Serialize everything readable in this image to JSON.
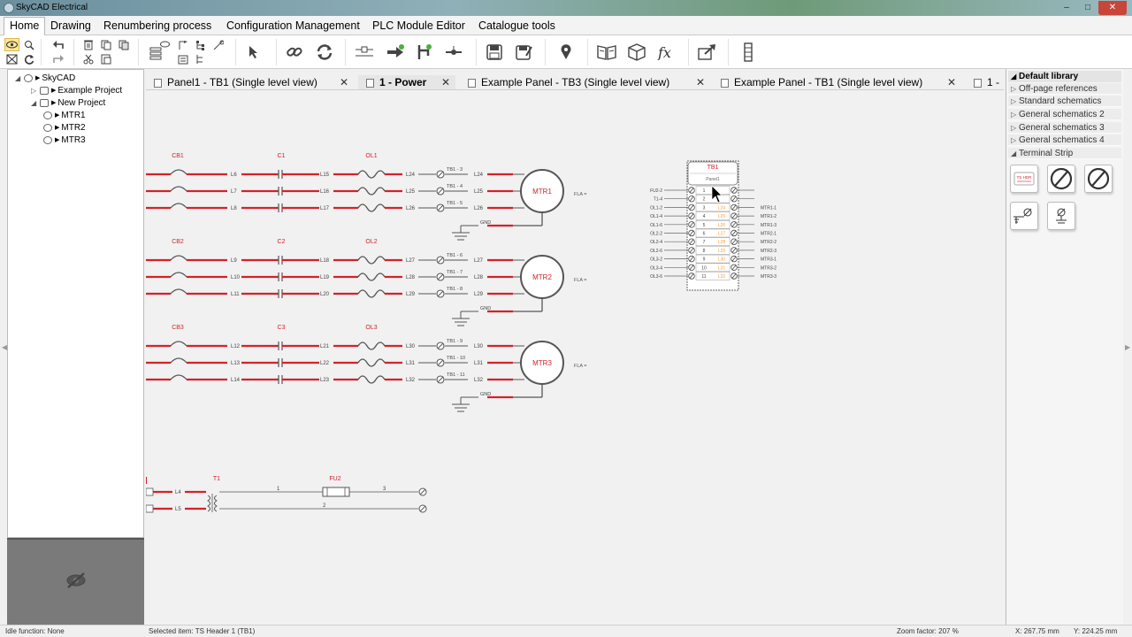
{
  "window": {
    "title": "SkyCAD Electrical",
    "minimize": "–",
    "maximize": "□",
    "close": "✕"
  },
  "menu": [
    "Home",
    "Drawing",
    "Renumbering process",
    "Configuration Management",
    "PLC Module Editor",
    "Catalogue tools"
  ],
  "tree": {
    "root": "SkyCAD",
    "projects": [
      "Example Project",
      "New Project"
    ],
    "children": [
      "MTR1",
      "MTR2",
      "MTR3"
    ]
  },
  "tabs": [
    {
      "label": "Panel1 - TB1 (Single level view)",
      "close": "✕"
    },
    {
      "label": "1 - Power",
      "close": "✕"
    },
    {
      "label": "Example Panel - TB3 (Single level view)",
      "close": "✕"
    },
    {
      "label": "Example Panel - TB1 (Single level view)",
      "close": "✕"
    },
    {
      "label": "1 -"
    }
  ],
  "library": {
    "header": "Default library",
    "items": [
      "Off-page references",
      "Standard schematics",
      "General schematics 2",
      "General schematics 3",
      "General schematics 4",
      "Terminal Strip"
    ],
    "symbol_label": "TS HDR"
  },
  "schematic": {
    "rows": [
      {
        "cb": "CB1",
        "cap": "C1",
        "ol": "OL1",
        "motor": "MTR1",
        "fla": "FLA =",
        "wires_a": [
          "L6",
          "L7",
          "L8"
        ],
        "wires_b": [
          "L15",
          "L16",
          "L17"
        ],
        "wires_c": [
          "L24",
          "L25",
          "L26"
        ],
        "tb": [
          "TB1 - 3",
          "TB1 - 4",
          "TB1 - 5"
        ],
        "wires_d": [
          "L24",
          "L25",
          "L26"
        ]
      },
      {
        "cb": "CB2",
        "cap": "C2",
        "ol": "OL2",
        "motor": "MTR2",
        "fla": "FLA =",
        "wires_a": [
          "L9",
          "L10",
          "L11"
        ],
        "wires_b": [
          "L18",
          "L19",
          "L20"
        ],
        "wires_c": [
          "L27",
          "L28",
          "L29"
        ],
        "tb": [
          "TB1 - 6",
          "TB1 - 7",
          "TB1 - 8"
        ],
        "wires_d": [
          "L27",
          "L28",
          "L29"
        ]
      },
      {
        "cb": "CB3",
        "cap": "C3",
        "ol": "OL3",
        "motor": "MTR3",
        "fla": "FLA =",
        "wires_a": [
          "L12",
          "L13",
          "L14"
        ],
        "wires_b": [
          "L21",
          "L22",
          "L23"
        ],
        "wires_c": [
          "L30",
          "L31",
          "L32"
        ],
        "tb": [
          "TB1 - 9",
          "TB1 - 10",
          "TB1 - 11"
        ],
        "wires_d": [
          "L30",
          "L31",
          "L32"
        ]
      }
    ],
    "pin_labels": [
      "1",
      "2",
      "3",
      "4"
    ],
    "gnd": "GND",
    "terminal_block": {
      "title": "TB1",
      "subtitle": "Panel1",
      "left": [
        "FU2-2",
        "T1-4",
        "OL1-2",
        "OL1-4",
        "OL1-6",
        "OL2-2",
        "OL2-4",
        "OL2-6",
        "OL3-2",
        "OL3-4",
        "OL3-6"
      ],
      "nums": [
        "1",
        "2",
        "3",
        "4",
        "5",
        "6",
        "7",
        "8",
        "9",
        "10",
        "11"
      ],
      "wires": [
        "",
        "",
        "L24",
        "L25",
        "L26",
        "L27",
        "L28",
        "L29",
        "L30",
        "L31",
        "L32"
      ],
      "right": [
        "",
        "",
        "MTR1-1",
        "MTR1-2",
        "MTR1-3",
        "MTR2-1",
        "MTR2-2",
        "MTR2-3",
        "MTR3-1",
        "MTR3-2",
        "MTR3-3"
      ]
    },
    "bottom": {
      "t1": "T1",
      "fu2": "FU2",
      "wires": [
        "L4",
        "L5"
      ],
      "nums": [
        "1",
        "2",
        "3"
      ]
    }
  },
  "status": {
    "idle": "Idle function: None",
    "selected": "Selected item: TS Header 1 (TB1)",
    "zoom": "Zoom factor: 207 %",
    "x": "X: 267.75 mm",
    "y": "Y: 224.25 mm"
  },
  "colors": {
    "wire": "#d2232a",
    "line": "#555555",
    "accent": "#f7a13a"
  }
}
